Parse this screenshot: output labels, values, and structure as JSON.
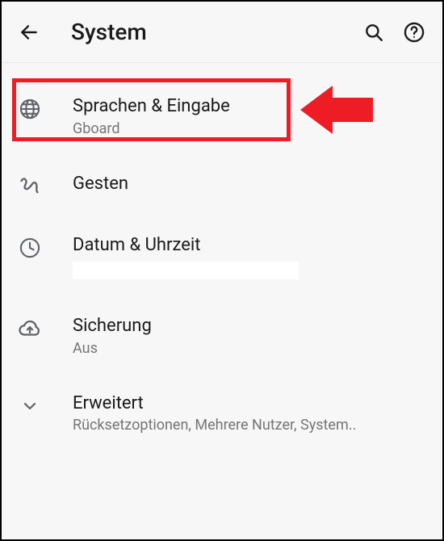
{
  "header": {
    "title": "System"
  },
  "items": [
    {
      "title": "Sprachen & Eingabe",
      "subtitle": "Gboard"
    },
    {
      "title": "Gesten",
      "subtitle": ""
    },
    {
      "title": "Datum & Uhrzeit",
      "subtitle": ""
    },
    {
      "title": "Sicherung",
      "subtitle": "Aus"
    },
    {
      "title": "Erweitert",
      "subtitle": "Rücksetzoptionen, Mehrere Nutzer, System.."
    }
  ]
}
